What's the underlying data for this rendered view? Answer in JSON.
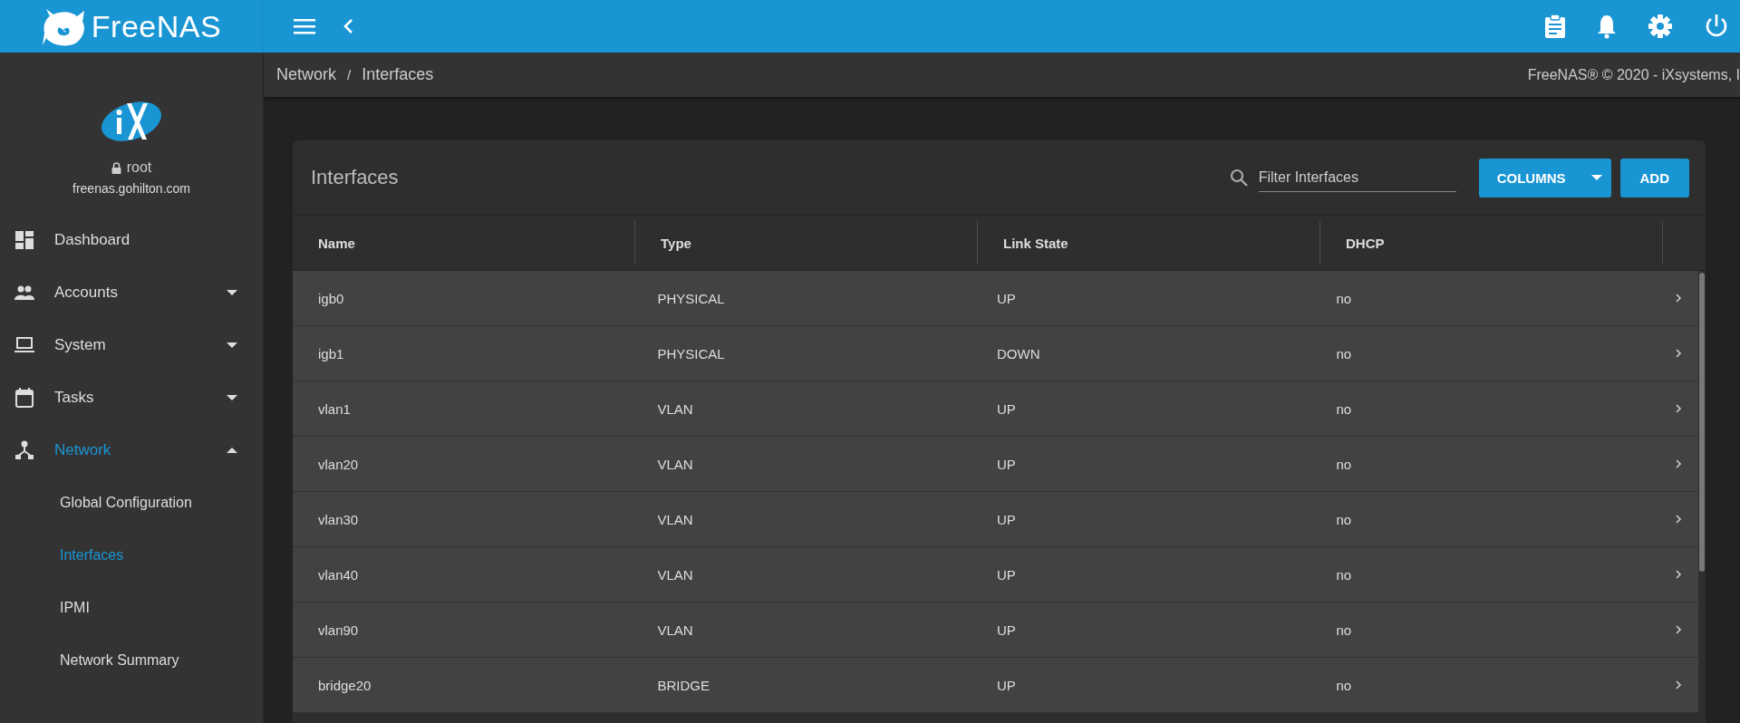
{
  "brand": {
    "name": "FreeNAS"
  },
  "user": {
    "name": "root",
    "host": "freenas.gohilton.com"
  },
  "sidebar": {
    "items": [
      {
        "label": "Dashboard",
        "kind": "link",
        "selected": false
      },
      {
        "label": "Accounts",
        "kind": "group",
        "selected": false,
        "expanded": false
      },
      {
        "label": "System",
        "kind": "group",
        "selected": false,
        "expanded": false
      },
      {
        "label": "Tasks",
        "kind": "group",
        "selected": false,
        "expanded": false
      },
      {
        "label": "Network",
        "kind": "group",
        "selected": true,
        "expanded": true,
        "children": [
          {
            "label": "Global Configuration",
            "selected": false
          },
          {
            "label": "Interfaces",
            "selected": true
          },
          {
            "label": "IPMI",
            "selected": false
          },
          {
            "label": "Network Summary",
            "selected": false
          }
        ]
      }
    ]
  },
  "breadcrumb": [
    "Network",
    "/",
    "Interfaces"
  ],
  "copyright": "FreeNAS® © 2020 - iXsystems, I",
  "card": {
    "title": "Interfaces",
    "filter": {
      "placeholder": "Filter Interfaces"
    },
    "buttons": [
      "COLUMNS",
      "ADD"
    ]
  },
  "table": {
    "columns": [
      "Name",
      "Type",
      "Link State",
      "DHCP"
    ],
    "rows": [
      {
        "cells": [
          "igb0",
          "PHYSICAL",
          "UP",
          "no"
        ]
      },
      {
        "cells": [
          "igb1",
          "PHYSICAL",
          "DOWN",
          "no"
        ]
      },
      {
        "cells": [
          "vlan1",
          "VLAN",
          "UP",
          "no"
        ]
      },
      {
        "cells": [
          "vlan20",
          "VLAN",
          "UP",
          "no"
        ]
      },
      {
        "cells": [
          "vlan30",
          "VLAN",
          "UP",
          "no"
        ]
      },
      {
        "cells": [
          "vlan40",
          "VLAN",
          "UP",
          "no"
        ]
      },
      {
        "cells": [
          "vlan90",
          "VLAN",
          "UP",
          "no"
        ]
      },
      {
        "cells": [
          "bridge20",
          "BRIDGE",
          "UP",
          "no"
        ]
      }
    ]
  }
}
